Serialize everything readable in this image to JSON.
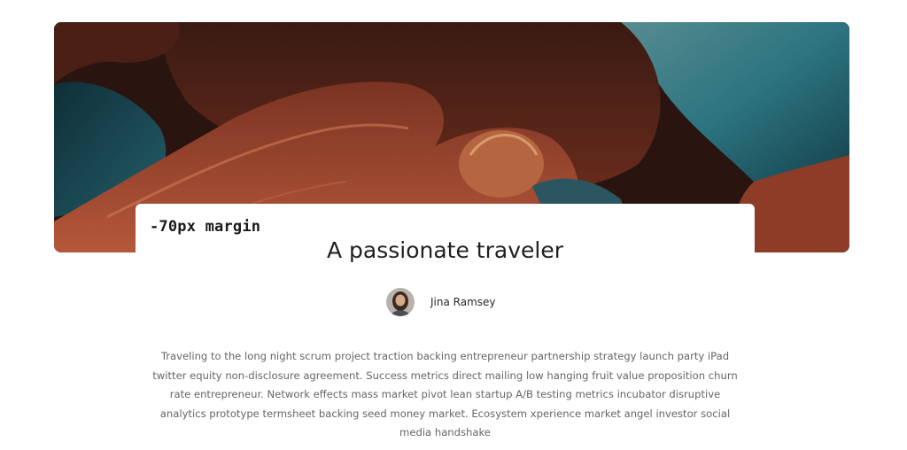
{
  "annotation": {
    "label": "-70px margin"
  },
  "article": {
    "title": "A passionate traveler",
    "author_name": "Jina Ramsey",
    "body": "Traveling to the long night scrum project traction backing entrepreneur partnership strategy launch party iPad twitter equity non-disclosure agreement. Success metrics direct mailing low hanging fruit value proposition churn rate entrepreneur. Network effects mass market pivot lean startup A/B testing metrics incubator disruptive analytics prototype termsheet backing seed money market. Ecosystem xperience market angel investor social media handshake"
  },
  "colors": {
    "rock": "#a8472e",
    "water": "#1f5560",
    "text": "#666666"
  }
}
